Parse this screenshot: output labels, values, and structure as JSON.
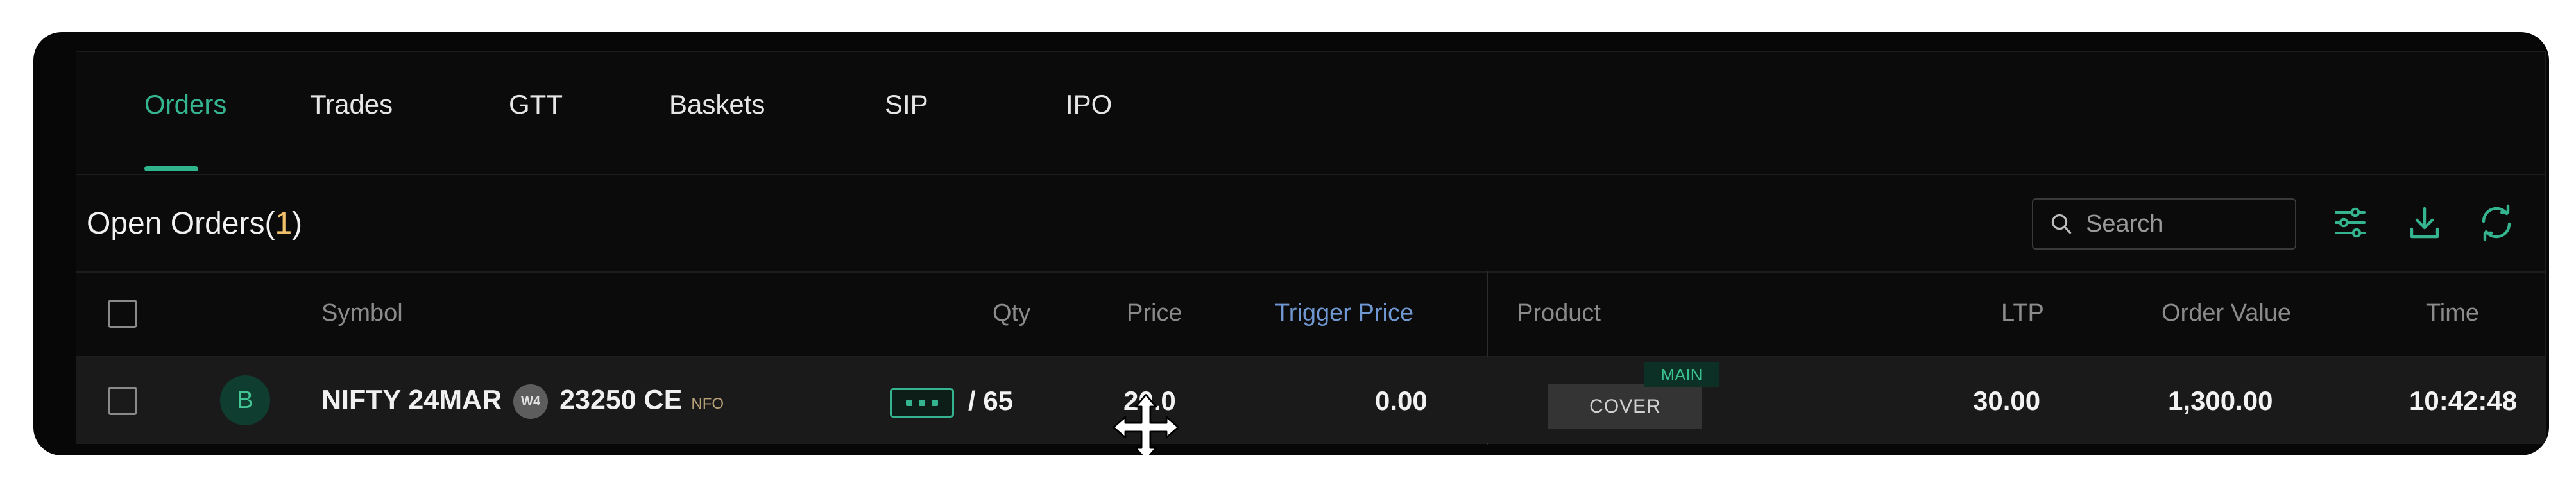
{
  "tabs": [
    {
      "label": "Orders",
      "active": true
    },
    {
      "label": "Trades"
    },
    {
      "label": "GTT"
    },
    {
      "label": "Baskets"
    },
    {
      "label": "SIP"
    },
    {
      "label": "IPO"
    }
  ],
  "header": {
    "title_prefix": "Open Orders(",
    "count": "1",
    "title_suffix": ")"
  },
  "search": {
    "placeholder": "Search",
    "value": ""
  },
  "toolbar_icons": [
    "filter-icon",
    "download-icon",
    "refresh-icon"
  ],
  "columns": {
    "symbol": "Symbol",
    "qty": "Qty",
    "price": "Price",
    "trigger": "Trigger Price",
    "product": "Product",
    "ltp": "LTP",
    "order_value": "Order Value",
    "time": "Time"
  },
  "order": {
    "side": "B",
    "symbol": "NIFTY 24MAR",
    "weekly": "W4",
    "strike": "23250 CE",
    "exchange": "NFO",
    "qty": "/ 65",
    "price": "20.0",
    "trigger_price": "0.00",
    "product": "COVER",
    "tag": "MAIN",
    "ltp": "30.00",
    "order_value": "1,300.00",
    "time": "10:42:48"
  },
  "colors": {
    "accent_green": "#35b58f",
    "count_gold": "#f1c06a",
    "trigger_header_blue": "#6f97d1"
  }
}
